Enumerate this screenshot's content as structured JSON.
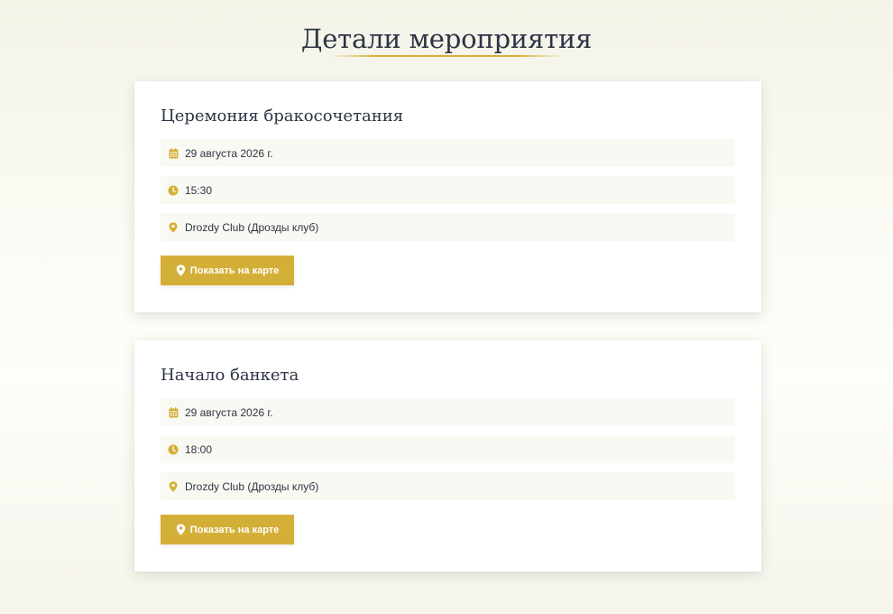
{
  "page": {
    "title": "Детали мероприятия"
  },
  "events": [
    {
      "title": "Церемония бракосочетания",
      "date": "29 августа 2026 г.",
      "time": "15:30",
      "place": "Drozdy Club (Дрозды клуб)",
      "map_button": "Показать на карте"
    },
    {
      "title": "Начало банкета",
      "date": "29 августа 2026 г.",
      "time": "18:00",
      "place": "Drozdy Club (Дрозды клуб)",
      "map_button": "Показать на карте"
    }
  ],
  "icons": {
    "date": "calendar-icon",
    "time": "clock-icon",
    "place": "map-pin-icon",
    "button": "map-pin-icon"
  },
  "colors": {
    "accent": "#d4af37",
    "text": "#2c3444",
    "row_background": "#f9f9f3"
  }
}
